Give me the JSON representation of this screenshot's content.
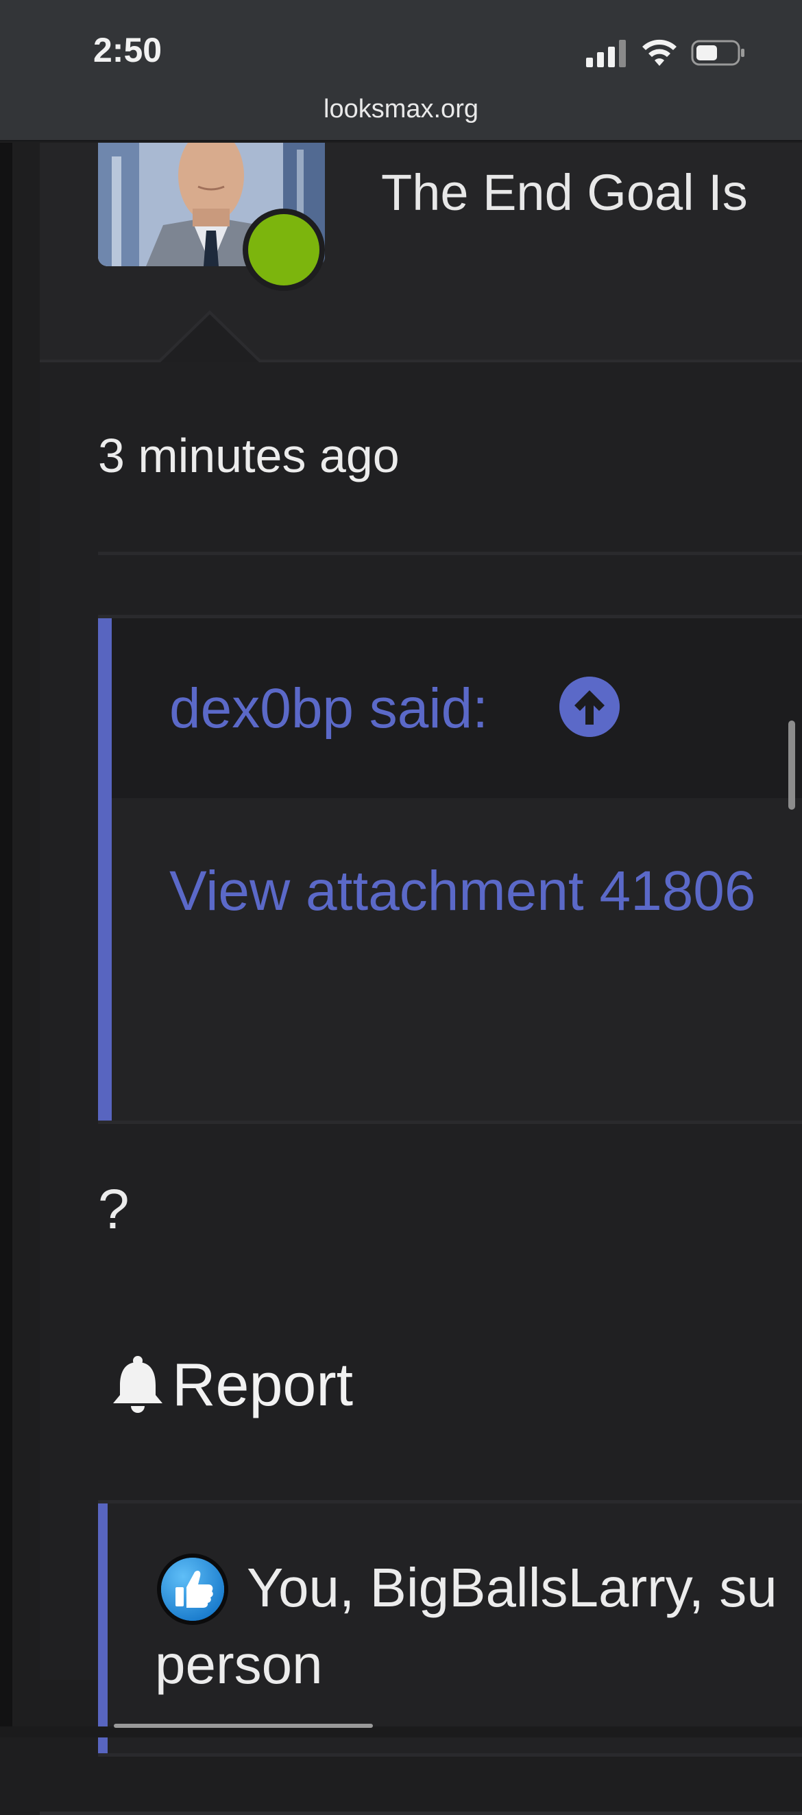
{
  "status_bar": {
    "time": "2:50"
  },
  "browser": {
    "url": "looksmax.org"
  },
  "post": {
    "user_title": "The End Goal Is",
    "timestamp": "3 minutes ago",
    "quote": {
      "author_said": "dex0bp said:",
      "attachment_link": "View attachment 41806"
    },
    "body_text": "?",
    "report_label": "Report",
    "reactions": {
      "line1": "You, BigBallsLarry, su",
      "line2": "person"
    }
  },
  "colors": {
    "accent": "#5b69c8",
    "online": "#7cb50d",
    "background": "#1e1e1f",
    "status_bar": "#333538"
  },
  "icons": {
    "signal": "cellular-signal-icon",
    "wifi": "wifi-icon",
    "battery": "battery-icon",
    "jump_to_quote": "arrow-up-circle-icon",
    "report": "bell-icon",
    "reaction": "thumbs-up-icon"
  }
}
